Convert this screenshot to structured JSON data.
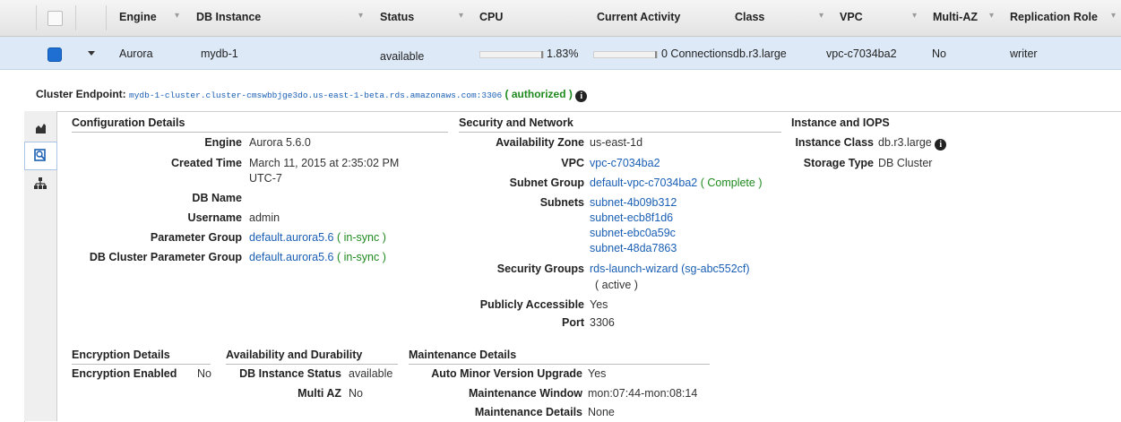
{
  "columns": [
    {
      "label": "Engine"
    },
    {
      "label": "DB Instance"
    },
    {
      "label": "Status"
    },
    {
      "label": "CPU"
    },
    {
      "label": "Current Activity"
    },
    {
      "label": "Class"
    },
    {
      "label": "VPC"
    },
    {
      "label": "Multi-AZ"
    },
    {
      "label": "Replication Role"
    }
  ],
  "row": {
    "engine": "Aurora",
    "instance": "mydb-1",
    "status": "available",
    "cpu": "1.83%",
    "cpu_fraction": 0.0183,
    "activity": "0 Connections",
    "class": "db.r3.large",
    "vpc": "vpc-c7034ba2",
    "multi_az": "No",
    "role": "writer"
  },
  "endpoint": {
    "label": "Cluster Endpoint:",
    "url": "mydb-1-cluster.cluster-cmswbbjge3do.us-east-1-beta.rds.amazonaws.com:3306",
    "status": "( authorized )"
  },
  "config": {
    "title": "Configuration Details",
    "engine_label": "Engine",
    "engine": "Aurora 5.6.0",
    "created_label": "Created Time",
    "created_1": "March 11, 2015 at 2:35:02 PM",
    "created_2": "UTC-7",
    "dbname_label": "DB Name",
    "username_label": "Username",
    "username": "admin",
    "pg_label": "Parameter Group",
    "pg": "default.aurora5.6",
    "pg_status": "( in-sync )",
    "cpg_label": "DB Cluster Parameter Group",
    "cpg": "default.aurora5.6",
    "cpg_status": "( in-sync )"
  },
  "security": {
    "title": "Security and Network",
    "az_label": "Availability Zone",
    "az": "us-east-1d",
    "vpc_label": "VPC",
    "vpc": "vpc-c7034ba2",
    "subnetgroup_label": "Subnet Group",
    "subnetgroup": "default-vpc-c7034ba2",
    "subnetgroup_status": "( Complete )",
    "subnets_label": "Subnets",
    "subnets": [
      "subnet-4b09b312",
      "subnet-ecb8f1d6",
      "subnet-ebc0a59c",
      "subnet-48da7863"
    ],
    "sg_label": "Security Groups",
    "sg": "rds-launch-wizard (sg-abc552cf)",
    "sg_status": "( active )",
    "public_label": "Publicly Accessible",
    "public": "Yes",
    "port_label": "Port",
    "port": "3306"
  },
  "iops": {
    "title": "Instance and IOPS",
    "class_label": "Instance Class",
    "class": "db.r3.large",
    "storage_label": "Storage Type",
    "storage": "DB Cluster"
  },
  "encryption": {
    "title": "Encryption Details",
    "enabled_label": "Encryption Enabled",
    "enabled": "No"
  },
  "availability": {
    "title": "Availability and Durability",
    "status_label": "DB Instance Status",
    "status": "available",
    "multiaz_label": "Multi AZ",
    "multiaz": "No"
  },
  "maintenance": {
    "title": "Maintenance Details",
    "upgrade_label": "Auto Minor Version Upgrade",
    "upgrade": "Yes",
    "window_label": "Maintenance Window",
    "window": "mon:07:44-mon:08:14",
    "details_label": "Maintenance Details",
    "details": "None"
  },
  "colors": {
    "accent": "#1a5fb4",
    "ok": "#1e8a1e",
    "selected_row": "#dde9f7"
  }
}
